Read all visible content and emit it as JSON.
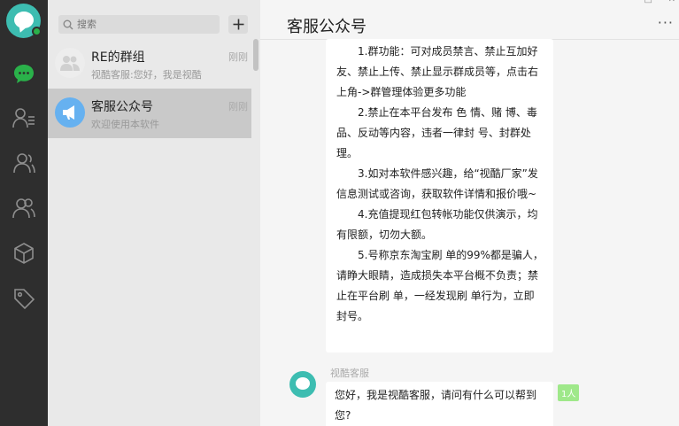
{
  "search": {
    "placeholder": "搜索"
  },
  "conversations": [
    {
      "name": "RE的群组",
      "preview": "视酷客服:您好，我是视酷",
      "time": "刚刚"
    },
    {
      "name": "客服公众号",
      "preview": "欢迎使用本软件",
      "time": "刚刚"
    }
  ],
  "chat": {
    "title": "客服公众号",
    "notice": [
      "1.群功能：可对成员禁言、禁止互加好友、禁止上传、禁止显示群成员等，点击右上角->群管理体验更多功能",
      "2.禁止在本平台发布 色 情、赌 博、毒 品、反动等内容，违者一律封 号、封群处理。",
      "3.如对本软件感兴趣，给“视酷厂家”发信息测试或咨询，获取软件详情和报价哦~",
      "4.充值提现红包转帐功能仅供演示，均有限额，切勿大额。",
      "5.号称京东淘宝刷 单的99%都是骗人，请睁大眼睛，造成损失本平台概不负责；禁止在平台刷 单，一经发现刷 单行为，立即封号。"
    ],
    "sender": "视酷客服",
    "reply": "您好，我是视酷客服，请问有什么可以帮到您?",
    "read_badge": "1人"
  },
  "colors": {
    "accent": "#3dbdb1",
    "nav_active": "#2ab14a",
    "rail": "#2e2e2e"
  }
}
